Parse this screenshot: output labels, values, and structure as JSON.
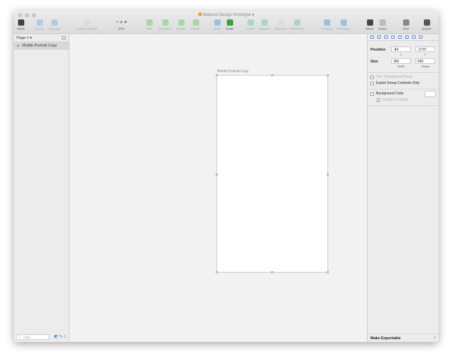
{
  "window": {
    "title": "Material Design Prototype"
  },
  "toolbar": [
    {
      "label": "Insert",
      "icon": "insert-icon",
      "color": "#444",
      "dark": true
    },
    {
      "label": "Group",
      "icon": "group-icon",
      "color": "#b8c8e8"
    },
    {
      "label": "Ungroup",
      "icon": "ungroup-icon",
      "color": "#b8c8e8"
    },
    {
      "label": "Create Symbol",
      "icon": "symbol-icon",
      "color": "#ddd"
    },
    {
      "label": "57%",
      "icon": "zoom-icon",
      "color": "#444",
      "dark": true
    },
    {
      "label": "Edit",
      "icon": "edit-icon",
      "color": "#a8d8a8"
    },
    {
      "label": "Transform",
      "icon": "transform-icon",
      "color": "#a8d8a8"
    },
    {
      "label": "Rotate",
      "icon": "rotate-icon",
      "color": "#a8d8a8"
    },
    {
      "label": "Flatten",
      "icon": "flatten-icon",
      "color": "#a8d8a8"
    },
    {
      "label": "Mask",
      "icon": "mask-icon",
      "color": "#9cc0e0"
    },
    {
      "label": "Scale",
      "icon": "scale-icon",
      "color": "#3aa040",
      "dark": true
    },
    {
      "label": "Union",
      "icon": "union-icon",
      "color": "#a8d8c0"
    },
    {
      "label": "Subtract",
      "icon": "subtract-icon",
      "color": "#a8d8c0"
    },
    {
      "label": "Intersect",
      "icon": "intersect-icon",
      "color": "#ddd"
    },
    {
      "label": "Difference",
      "icon": "difference-icon",
      "color": "#a8d8c0"
    },
    {
      "label": "Forward",
      "icon": "forward-icon",
      "color": "#9cc0e0"
    },
    {
      "label": "Backward",
      "icon": "backward-icon",
      "color": "#9cc0e0"
    },
    {
      "label": "Mirror",
      "icon": "mirror-icon",
      "color": "#444",
      "dark": true
    },
    {
      "label": "Cloud",
      "icon": "cloud-icon",
      "color": "#bbb",
      "dark": true
    },
    {
      "label": "View",
      "icon": "view-icon",
      "color": "#888",
      "dark": true
    },
    {
      "label": "Export",
      "icon": "export-icon",
      "color": "#555",
      "dark": true
    }
  ],
  "sidebar": {
    "page": "Page 1",
    "layers": [
      "Mobile Portrait Copy"
    ],
    "filter_placeholder": "Filter"
  },
  "canvas": {
    "artboard_label": "Mobile Portrait Copy"
  },
  "inspector": {
    "position_label": "Position",
    "x": "-84",
    "y": "-2747",
    "x_label": "X",
    "y_label": "Y",
    "size_label": "Size",
    "width": "360",
    "height": "640",
    "width_label": "Width",
    "height_label": "Height",
    "trim": "Trim Transparent Pixels",
    "export_group": "Export Group Contents Only",
    "bg_color": "Background Color",
    "include_export": "Include in Export",
    "make_exportable": "Make Exportable"
  }
}
